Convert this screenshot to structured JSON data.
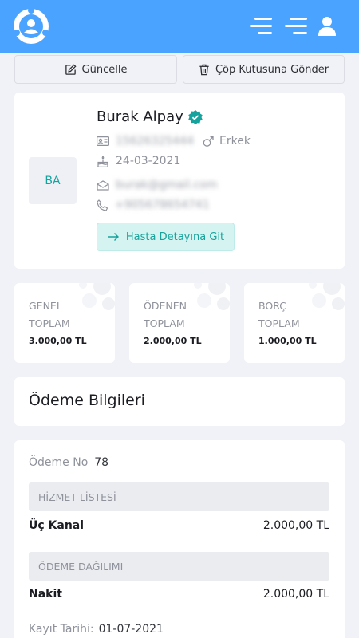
{
  "toolbar": {
    "update_label": "Güncelle",
    "trash_label": "Çöp Kutusuna Gönder"
  },
  "patient": {
    "initials": "BA",
    "name": "Burak Alpay",
    "id_number": "15626325444",
    "gender": "Erkek",
    "birth_date": "24-03-2021",
    "email": "burak@gmail.com",
    "phone": "+905678654741",
    "detail_label": "Hasta Detayına Git"
  },
  "stats": [
    {
      "label": "GENEL TOPLAM",
      "value": "3.000,00 TL"
    },
    {
      "label": "ÖDENEN TOPLAM",
      "value": "2.000,00 TL"
    },
    {
      "label": "BORÇ TOPLAM",
      "value": "1.000,00 TL"
    }
  ],
  "payment": {
    "title": "Ödeme Bilgileri",
    "no_label": "Ödeme No",
    "no_value": "78",
    "services_header": "HİZMET LİSTESİ",
    "services": [
      {
        "name": "Üç Kanal",
        "amount": "2.000,00 TL"
      }
    ],
    "distribution_header": "ÖDEME DAĞILIMI",
    "distribution": [
      {
        "name": "Nakit",
        "amount": "2.000,00 TL"
      }
    ],
    "record_label": "Kayıt Tarihi:",
    "record_date": "01-07-2021"
  },
  "colors": {
    "header": "#4aa3ff",
    "accent": "#16a39d",
    "background": "#f1f2f7"
  },
  "icons": [
    "logo-icon",
    "menu-icon",
    "menu-icon",
    "user-icon",
    "edit-icon",
    "trash-icon",
    "verified-icon",
    "id-card-icon",
    "gender-icon",
    "cake-icon",
    "mail-icon",
    "phone-icon",
    "arrow-right-icon"
  ]
}
